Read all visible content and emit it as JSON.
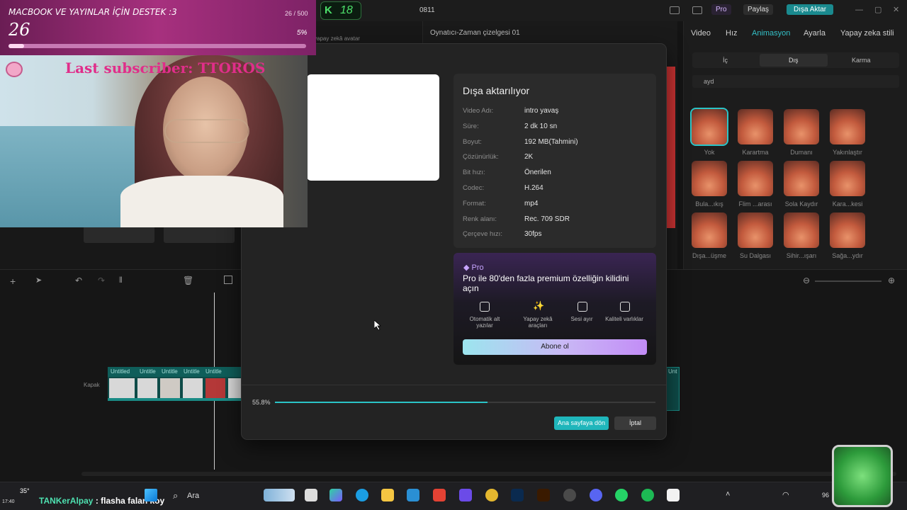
{
  "app": {
    "project_name": "0811",
    "pro_label": "Pro",
    "share_label": "Paylaş",
    "export_label": "Dışa Aktar",
    "player_title": "Oynatıcı-Zaman çizelgesi 01",
    "ai_avatar_label": "yapay zekâ avatar"
  },
  "right_panel": {
    "tabs": [
      "Video",
      "Hız",
      "Animasyon",
      "Ayarla",
      "Yapay zeka stili"
    ],
    "active_tab": "Animasyon",
    "subtabs": [
      "İç",
      "Dış",
      "Karma"
    ],
    "search_value": "ayd",
    "effects": [
      [
        "Yok",
        "Karartma",
        "Dumanı",
        "Yakınlaştır"
      ],
      [
        "Bula...ıkış",
        "Flim ...arası",
        "Sola Kaydır",
        "Kara...kesi"
      ],
      [
        "Dışa...üşme",
        "Su Dalgası",
        "Sihir...ışarı",
        "Sağa...ydır"
      ]
    ]
  },
  "timeline": {
    "cover_label": "Kapak",
    "clip_label": "Untitled",
    "clip_label_short": "Untitle",
    "side_clip_label": "Unt"
  },
  "export_dialog": {
    "title": "Dışa aktarılıyor",
    "fields": [
      {
        "key": "Video Adı:",
        "value": "intro yavaş"
      },
      {
        "key": "Süre:",
        "value": "2 dk 10 sn"
      },
      {
        "key": "Boyut:",
        "value": "192 MB(Tahmini)"
      },
      {
        "key": "Çözünürlük:",
        "value": "2K"
      },
      {
        "key": "Bit hızı:",
        "value": "Önerilen"
      },
      {
        "key": "Codec:",
        "value": "H.264"
      },
      {
        "key": "Format:",
        "value": "mp4"
      },
      {
        "key": "Renk alanı:",
        "value": "Rec. 709 SDR"
      },
      {
        "key": "Çerçeve hızı:",
        "value": "30fps"
      }
    ],
    "pro_badge": "Pro",
    "pro_text": "Pro ile 80'den fazla premium özelliğin kilidini açın",
    "features": [
      "Otomatik alt yazılar",
      "Yapay zekâ araçları",
      "Sesi ayır",
      "Kaliteli varlıklar"
    ],
    "subscribe_label": "Abone ol",
    "progress_text": "55.8%",
    "progress": 0.558,
    "home_button": "Ana sayfaya dön",
    "cancel_button": "İptal"
  },
  "stream_overlay": {
    "goal_title": "MACBOOK VE YAYINLAR İÇİN DESTEK :3",
    "goal_value": "26",
    "goal_count": "26 / 500",
    "goal_percent": "5%",
    "goal_progress": 0.052,
    "last_subscriber": "Last subscriber: TTOROS",
    "kick_count": "18",
    "chat_user": "TANKerAlpay",
    "chat_message": ": flasha falan koy"
  },
  "taskbar": {
    "search_placeholder": "Ara",
    "weather": "35°",
    "time": "17:40",
    "battery_text": "96"
  },
  "colors": {
    "accent": "#2bc4c7",
    "export_button": "#1fb6bb",
    "goal_pink": "#a7307e",
    "kick_green": "#4de06a"
  }
}
